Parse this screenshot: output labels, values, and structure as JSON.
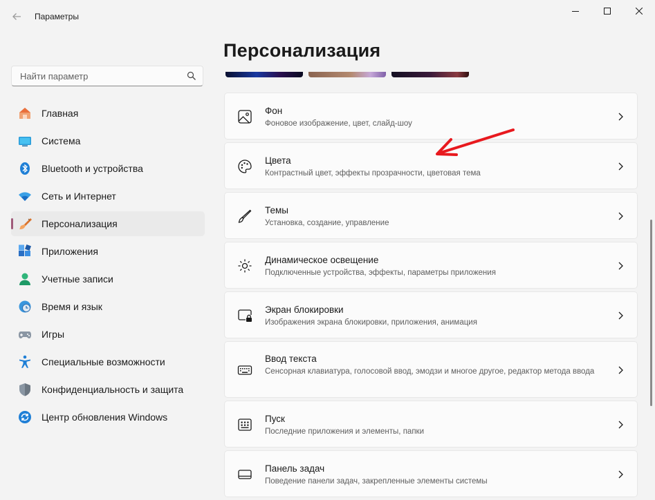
{
  "window": {
    "title": "Параметры",
    "controls": [
      "minimize",
      "maximize",
      "close"
    ]
  },
  "search": {
    "placeholder": "Найти параметр",
    "value": ""
  },
  "sidebar": {
    "items": [
      {
        "label": "Главная",
        "icon": "home-icon",
        "active": false
      },
      {
        "label": "Система",
        "icon": "system-icon",
        "active": false
      },
      {
        "label": "Bluetooth и устройства",
        "icon": "bluetooth-icon",
        "active": false
      },
      {
        "label": "Сеть и Интернет",
        "icon": "wifi-icon",
        "active": false
      },
      {
        "label": "Персонализация",
        "icon": "brush-icon",
        "active": true
      },
      {
        "label": "Приложения",
        "icon": "apps-icon",
        "active": false
      },
      {
        "label": "Учетные записи",
        "icon": "account-icon",
        "active": false
      },
      {
        "label": "Время и язык",
        "icon": "clock-globe-icon",
        "active": false
      },
      {
        "label": "Игры",
        "icon": "gamepad-icon",
        "active": false
      },
      {
        "label": "Специальные возможности",
        "icon": "accessibility-icon",
        "active": false
      },
      {
        "label": "Конфиденциальность и защита",
        "icon": "shield-icon",
        "active": false
      },
      {
        "label": "Центр обновления Windows",
        "icon": "update-icon",
        "active": false
      }
    ]
  },
  "main": {
    "title": "Персонализация",
    "cards": [
      {
        "title": "Фон",
        "subtitle": "Фоновое изображение, цвет, слайд-шоу",
        "icon": "picture-icon"
      },
      {
        "title": "Цвета",
        "subtitle": "Контрастный цвет, эффекты прозрачности, цветовая тема",
        "icon": "palette-icon"
      },
      {
        "title": "Темы",
        "subtitle": "Установка, создание, управление",
        "icon": "pen-brush-icon"
      },
      {
        "title": "Динамическое освещение",
        "subtitle": "Подключенные устройства, эффекты, параметры приложения",
        "icon": "lighting-icon"
      },
      {
        "title": "Экран блокировки",
        "subtitle": "Изображения экрана блокировки, приложения, анимация",
        "icon": "lock-screen-icon"
      },
      {
        "title": "Ввод текста",
        "subtitle": "Сенсорная клавиатура, голосовой ввод, эмодзи и многое другое, редактор метода ввода",
        "icon": "keyboard-icon"
      },
      {
        "title": "Пуск",
        "subtitle": "Последние приложения и элементы, папки",
        "icon": "start-menu-icon"
      },
      {
        "title": "Панель задач",
        "subtitle": "Поведение панели задач, закрепленные элементы системы",
        "icon": "taskbar-icon"
      }
    ]
  },
  "colors": {
    "accent": "#a05a7a",
    "background": "#f3f3f3",
    "card": "#fbfbfb",
    "annotation_arrow": "#e8191e"
  }
}
